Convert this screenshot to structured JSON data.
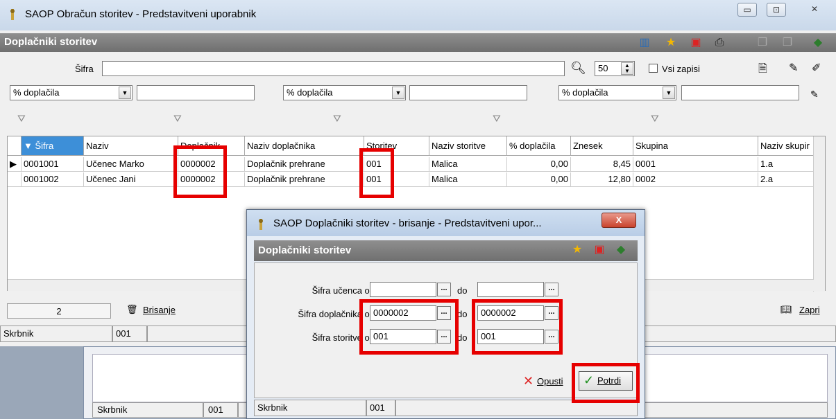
{
  "bg": {
    "status_left": "Skrbnik",
    "status_code": "001"
  },
  "window": {
    "title": "SAOP Obračun storitev - Predstavitveni uporabnik",
    "btn_min": "▭",
    "btn_max": "⊡",
    "btn_close": "✕"
  },
  "header": {
    "title": "Doplačniki storitev"
  },
  "search": {
    "label": "Šifra",
    "value": "",
    "page_size": "50",
    "all_records_label": "Vsi zapisi"
  },
  "filters": [
    {
      "field": "% doplačila",
      "value": ""
    },
    {
      "field": "% doplačila",
      "value": ""
    },
    {
      "field": "% doplačila",
      "value": ""
    }
  ],
  "grid": {
    "columns": [
      "▼ Šifra",
      "Naziv",
      "Doplačnik",
      "Naziv doplačnika",
      "Storitev",
      "Naziv storitve",
      "% doplačila",
      "Znesek",
      "Skupina",
      "Naziv skupir"
    ],
    "rows": [
      [
        "0001001",
        "Učenec Marko",
        "0000002",
        "Doplačnik prehrane",
        "001",
        "Malica",
        "0,00",
        "8,45",
        "0001",
        "1.a"
      ],
      [
        "0001002",
        "Učenec Jani",
        "0000002",
        "Doplačnik prehrane",
        "001",
        "Malica",
        "0,00",
        "12,80",
        "0002",
        "2.a"
      ]
    ]
  },
  "bottom": {
    "count": "2",
    "delete_label": "Brisanje",
    "close_label": "Zapri"
  },
  "status": {
    "left": "Skrbnik",
    "code": "001"
  },
  "dialog": {
    "title": "SAOP Doplačniki storitev - brisanje - Predstavitveni upor...",
    "close": "X",
    "header": "Doplačniki storitev",
    "fields": [
      {
        "label": "Šifra učenca od",
        "from": "",
        "to_label": "do",
        "to": ""
      },
      {
        "label": "Šifra doplačnika od",
        "from": "0000002",
        "to_label": "do",
        "to": "0000002"
      },
      {
        "label": "Šifra  storitve od",
        "from": "001",
        "to_label": "do",
        "to": "001"
      }
    ],
    "cancel_label": "Opusti",
    "confirm_label": "Potrdi",
    "status_left": "Skrbnik",
    "status_code": "001"
  },
  "colors": {
    "highlight": "#e60000",
    "sort_header": "#3d8fd8",
    "header_bar": "#7f7f7f"
  }
}
